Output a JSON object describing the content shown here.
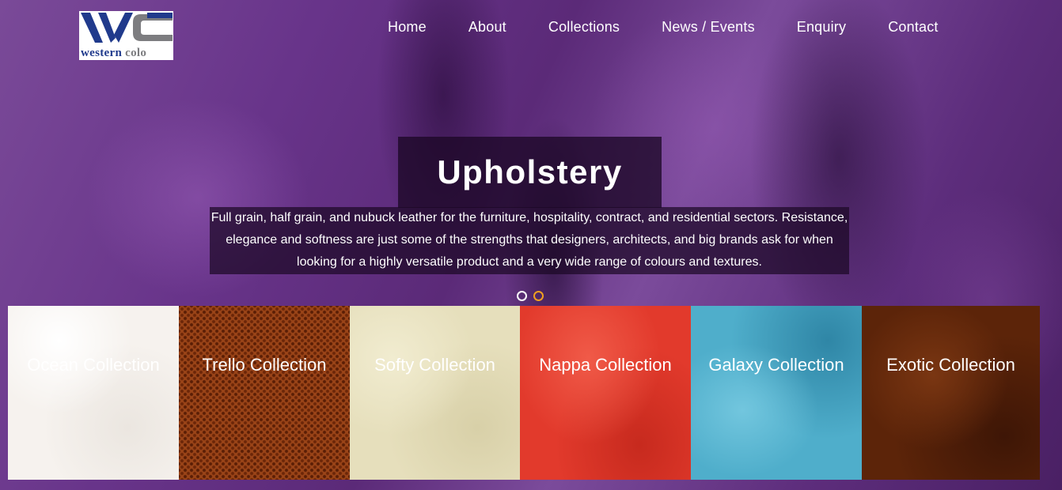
{
  "logo": {
    "text_main": "western",
    "text_accent": "colo"
  },
  "nav": {
    "items": [
      "Home",
      "About",
      "Collections",
      "News / Events",
      "Enquiry",
      "Contact"
    ]
  },
  "slide": {
    "title": "Upholstery",
    "description": "Full grain, half grain, and nubuck leather for the furniture, hospitality, contract, and residential sectors. Resistance, elegance and softness are just some of the strengths that designers, architects, and big brands ask for when looking for a highly versatile product and a very wide range of colours and textures.",
    "active_dot": 2,
    "dot_count": 2
  },
  "collections": [
    {
      "label": "Ocean Collection",
      "color": "#f6f2ee"
    },
    {
      "label": "Trello Collection",
      "color": "#9a4418"
    },
    {
      "label": "Softy Collection",
      "color": "#e6dfbc"
    },
    {
      "label": "Nappa Collection",
      "color": "#e23a2c"
    },
    {
      "label": "Galaxy Collection",
      "color": "#4faecb"
    },
    {
      "label": "Exotic Collection",
      "color": "#5c2409"
    }
  ],
  "colors": {
    "accent_dot": "#f0a020",
    "logo_blue": "#203a8c",
    "logo_grey": "#7d7d80"
  }
}
